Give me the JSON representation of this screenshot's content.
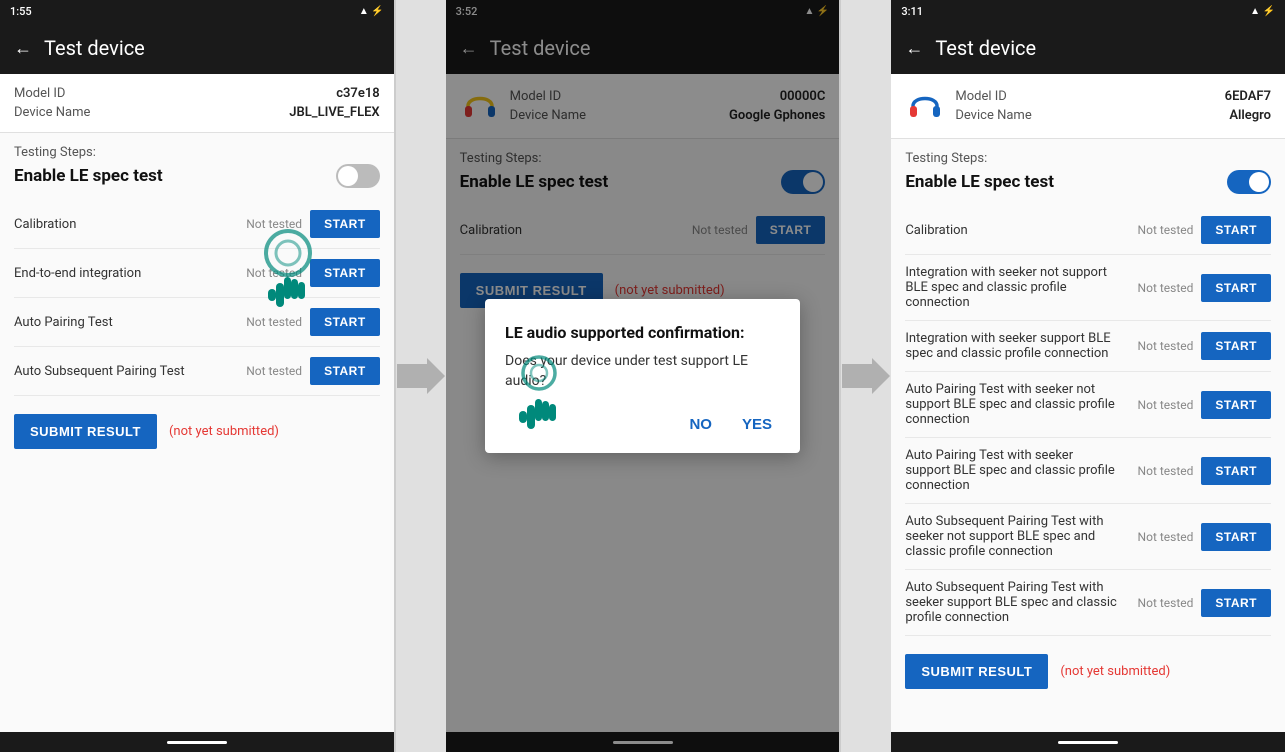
{
  "panels": [
    {
      "id": "panel1",
      "statusBar": {
        "time": "1:55",
        "icons": "⚙ ↺ !"
      },
      "appBar": {
        "title": "Test device",
        "backLabel": "←"
      },
      "device": {
        "hasIcon": false,
        "modelIdLabel": "Model ID",
        "modelIdValue": "c37e18",
        "deviceNameLabel": "Device Name",
        "deviceNameValue": "JBL_LIVE_FLEX"
      },
      "testingStepsLabel": "Testing Steps:",
      "enableLELabel": "Enable LE spec test",
      "toggleOn": false,
      "testRows": [
        {
          "label": "Calibration",
          "status": "Not tested",
          "btnLabel": "START"
        },
        {
          "label": "End-to-end integration",
          "status": "Not tested",
          "btnLabel": "START"
        },
        {
          "label": "Auto Pairing Test",
          "status": "Not tested",
          "btnLabel": "START"
        },
        {
          "label": "Auto Subsequent Pairing Test",
          "status": "Not tested",
          "btnLabel": "START"
        }
      ],
      "submitBtnLabel": "SUBMIT RESULT",
      "notSubmittedLabel": "(not yet submitted)",
      "hasCursor": true,
      "cursorTop": "220px",
      "cursorLeft": "270px",
      "hasOverlay": false,
      "hasDialog": false
    },
    {
      "id": "panel2",
      "statusBar": {
        "time": "3:52",
        "icons": "⚙ ⊙ ♡ ☁"
      },
      "appBar": {
        "title": "Test device",
        "backLabel": "←"
      },
      "device": {
        "hasIcon": true,
        "modelIdLabel": "Model ID",
        "modelIdValue": "00000C",
        "deviceNameLabel": "Device Name",
        "deviceNameValue": "Google Gphones"
      },
      "testingStepsLabel": "Testing Steps:",
      "enableLELabel": "Enable LE spec test",
      "toggleOn": true,
      "testRows": [
        {
          "label": "Calibration",
          "status": "Not tested",
          "btnLabel": "START"
        }
      ],
      "submitBtnLabel": "SUBMIT RESULT",
      "notSubmittedLabel": "(not yet submitted)",
      "hasCursor": true,
      "cursorTop": "380px",
      "cursorLeft": "600px",
      "hasOverlay": true,
      "hasDialog": true,
      "dialog": {
        "title": "LE audio supported confirmation:",
        "body": "Does your device under test support LE audio?",
        "noLabel": "NO",
        "yesLabel": "YES"
      }
    },
    {
      "id": "panel3",
      "statusBar": {
        "time": "3:11",
        "icons": "☺ △ ♡"
      },
      "appBar": {
        "title": "Test device",
        "backLabel": "←"
      },
      "device": {
        "hasIcon": true,
        "modelIdLabel": "Model ID",
        "modelIdValue": "6EDAF7",
        "deviceNameLabel": "Device Name",
        "deviceNameValue": "Allegro"
      },
      "testingStepsLabel": "Testing Steps:",
      "enableLELabel": "Enable LE spec test",
      "toggleOn": true,
      "testRows": [
        {
          "label": "Calibration",
          "status": "Not tested",
          "btnLabel": "START"
        },
        {
          "label": "Integration with seeker not support BLE spec and classic profile connection",
          "status": "Not tested",
          "btnLabel": "START"
        },
        {
          "label": "Integration with seeker support BLE spec and classic profile connection",
          "status": "Not tested",
          "btnLabel": "START"
        },
        {
          "label": "Auto Pairing Test with seeker not support BLE spec and classic profile connection",
          "status": "Not tested",
          "btnLabel": "START"
        },
        {
          "label": "Auto Pairing Test with seeker support BLE spec and classic profile connection",
          "status": "Not tested",
          "btnLabel": "START"
        },
        {
          "label": "Auto Subsequent Pairing Test with seeker not support BLE spec and classic profile connection",
          "status": "Not tested",
          "btnLabel": "START"
        },
        {
          "label": "Auto Subsequent Pairing Test with seeker support BLE spec and classic profile connection",
          "status": "Not tested",
          "btnLabel": "START"
        }
      ],
      "submitBtnLabel": "SUBMIT RESULT",
      "notSubmittedLabel": "(not yet submitted)",
      "hasCursor": false,
      "hasOverlay": false,
      "hasDialog": false
    }
  ],
  "arrows": [
    {
      "id": "arrow1"
    },
    {
      "id": "arrow2"
    }
  ]
}
